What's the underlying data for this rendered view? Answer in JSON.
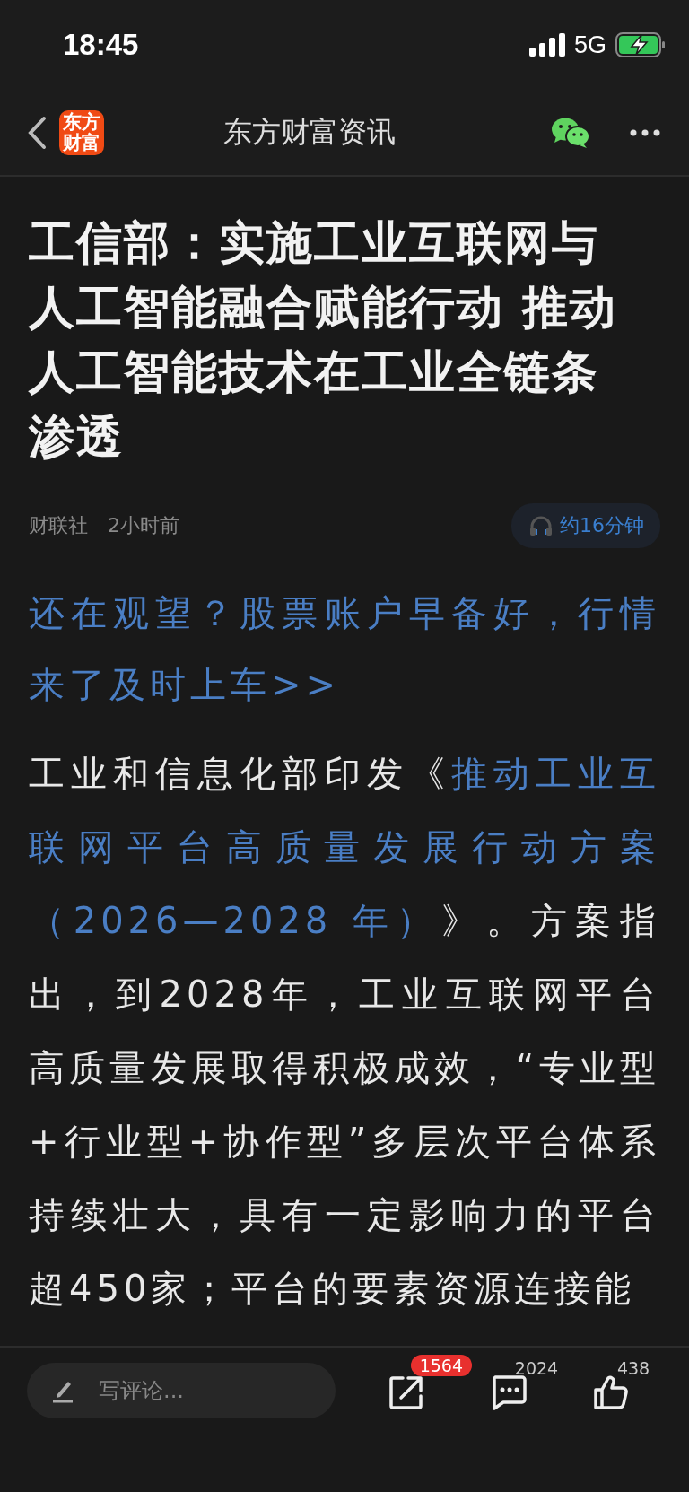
{
  "status_bar": {
    "time": "18:45",
    "network": "5G"
  },
  "nav": {
    "logo": "东方财富",
    "title": "东方财富资讯"
  },
  "article": {
    "title": "工信部：实施工业互联网与人工智能融合赋能行动 推动人工智能技术在工业全链条渗透",
    "source": "财联社",
    "time": "2小时前",
    "listen": "约16分钟",
    "promo": "还在观望？股票账户早备好，行情来了及时上车>>",
    "paragraph": [
      {
        "kind": "plain",
        "text": "工业和信息化部印发《"
      },
      {
        "kind": "link",
        "text": "推动工业互联网平台高质量发展行动方案（2026—2028 年）"
      },
      {
        "kind": "plain",
        "text": "》。方案指出，到2028年，工业互联网平台高质量发展取得积极成效，“专业型+行业型+协作型”多层次平台体系持续壮大，具有一定影响力的平台超450家；平台的要素资源连接能"
      }
    ]
  },
  "bottom_bar": {
    "comment_placeholder": "写评论...",
    "share_count": "1564",
    "comment_count": "2024",
    "like_count": "438"
  }
}
